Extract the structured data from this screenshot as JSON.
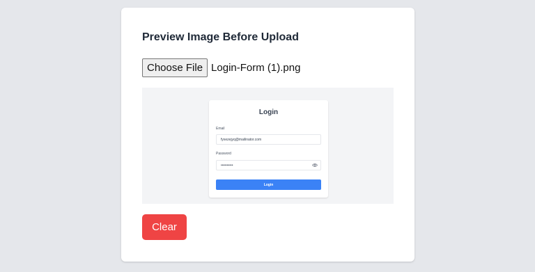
{
  "card": {
    "title": "Preview Image Before Upload"
  },
  "file_input": {
    "button_label": "Choose File",
    "file_name": "Login-Form (1).png"
  },
  "preview": {
    "login_title": "Login",
    "email_label": "Email",
    "email_value": "fyxezejyq@mailinator.com",
    "password_label": "Password",
    "password_value": "••••••••••",
    "eye_icon": "eye-icon",
    "login_button": "Login"
  },
  "actions": {
    "clear_label": "Clear"
  },
  "colors": {
    "background": "#e5e7eb",
    "clear_button": "#ef4444",
    "login_button": "#3b82f6"
  }
}
